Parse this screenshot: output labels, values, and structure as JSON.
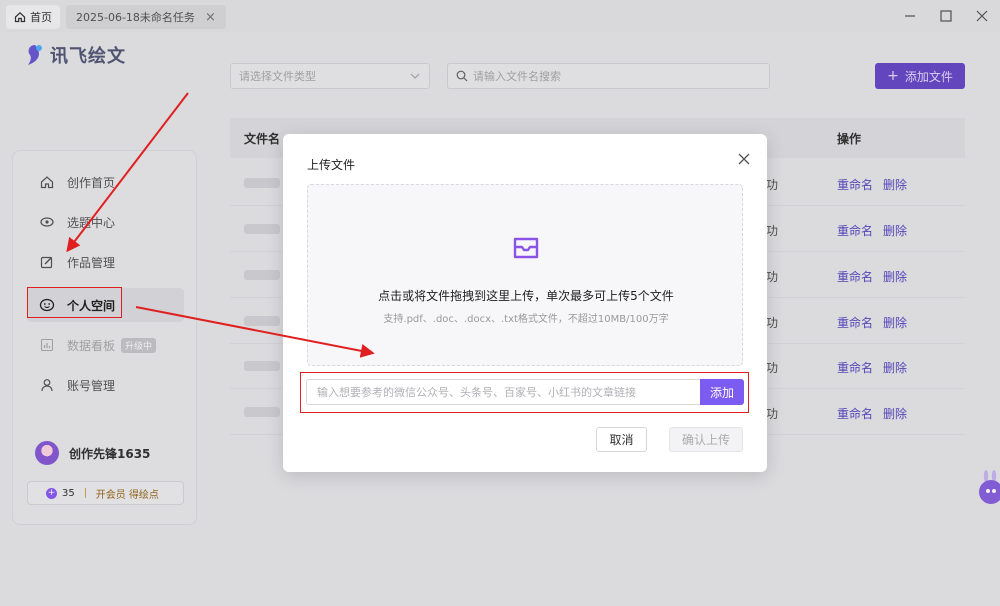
{
  "titlebar": {
    "home_tab": "首页",
    "task_tab": "2025-06-18未命名任务"
  },
  "logo": {
    "text": "讯飞绘文"
  },
  "sidebar": {
    "items": [
      {
        "label": "创作首页",
        "icon": "home-icon"
      },
      {
        "label": "选题中心",
        "icon": "eye-icon"
      },
      {
        "label": "作品管理",
        "icon": "edit-icon"
      },
      {
        "label": "个人空间",
        "icon": "smile-icon",
        "active": true
      },
      {
        "label": "数据看板",
        "icon": "chart-icon",
        "badge": "升级中",
        "disabled": true
      },
      {
        "label": "账号管理",
        "icon": "user-icon"
      }
    ],
    "user": {
      "name": "创作先锋1635"
    },
    "points": {
      "count": "35",
      "vip_text": "开会员 得绘点"
    }
  },
  "toolbar": {
    "file_type_placeholder": "请选择文件类型",
    "search_placeholder": "请输入文件名搜索",
    "add_file_label": "添加文件"
  },
  "table": {
    "col_filename": "文件名",
    "col_actions": "操作",
    "rows": [
      {
        "status": "功",
        "rename": "重命名",
        "delete": "删除"
      },
      {
        "status": "功",
        "rename": "重命名",
        "delete": "删除"
      },
      {
        "status": "功",
        "rename": "重命名",
        "delete": "删除"
      },
      {
        "status": "功",
        "rename": "重命名",
        "delete": "删除"
      },
      {
        "status": "功",
        "rename": "重命名",
        "delete": "删除"
      },
      {
        "status": "功",
        "rename": "重命名",
        "delete": "删除"
      }
    ]
  },
  "modal": {
    "title": "上传文件",
    "drop_hint": "点击或将文件拖拽到这里上传，单次最多可上传5个文件",
    "drop_sub": "支持.pdf、.doc、.docx、.txt格式文件，不超过10MB/100万字",
    "link_placeholder": "输入想要参考的微信公众号、头条号、百家号、小红书的文章链接",
    "link_value": "",
    "add_label": "添加",
    "cancel_label": "取消",
    "confirm_label": "确认上传"
  },
  "colors": {
    "accent": "#7c5cf0",
    "annotation": "#e02020"
  }
}
